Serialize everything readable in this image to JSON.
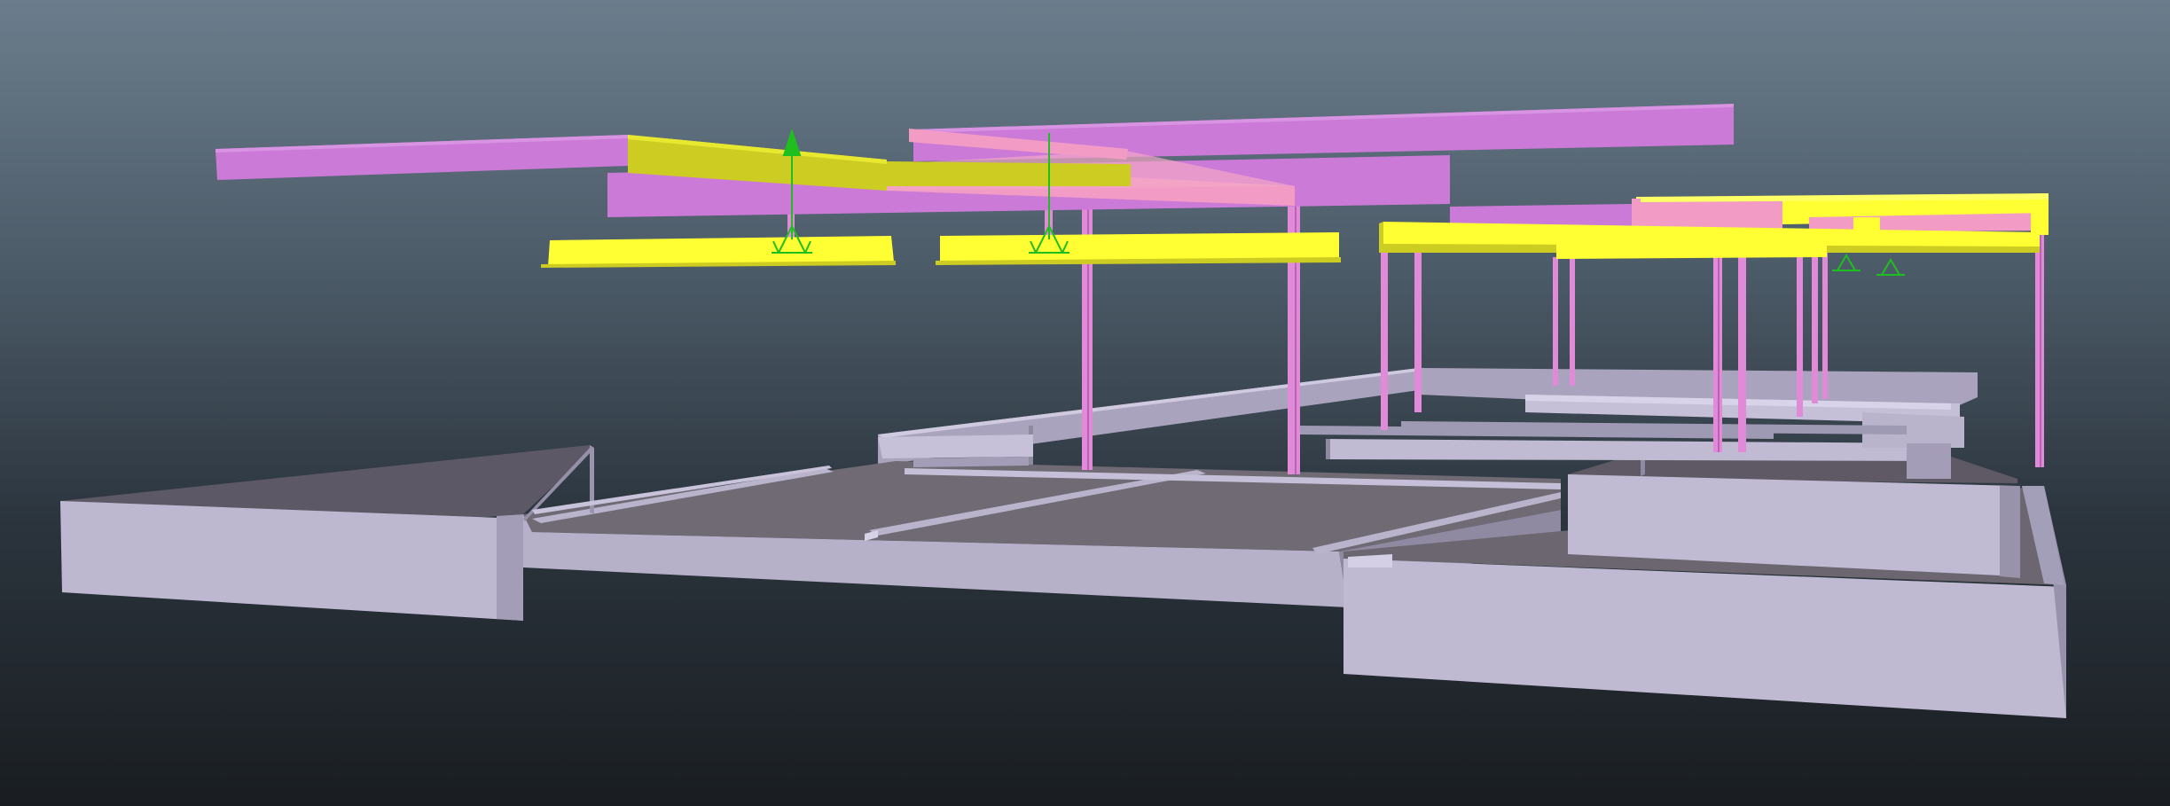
{
  "viewport": {
    "background_top": "#6b7d8c",
    "background_bottom": "#191d21"
  },
  "colors": {
    "slab_side": "#b8b2cc",
    "slab_top": "#6c6670",
    "slab_edge": "#8e8aa0",
    "wall_face": "#bfb9d2",
    "column": "#e08ad8",
    "column_dark": "#b863b4",
    "beam_magenta": "#cc7ad8",
    "beam_pink": "#f29bc4",
    "beam_yellow": "#ffff33",
    "beam_yellow_dark": "#cccc22",
    "symbol_green": "#1fbf1f"
  },
  "symbols": [
    {
      "name": "support-symbol-1",
      "icon": "green-arrow-icon"
    },
    {
      "name": "support-symbol-2",
      "icon": "green-arrow-icon"
    },
    {
      "name": "support-symbol-3",
      "icon": "green-arrow-icon"
    },
    {
      "name": "support-symbol-4",
      "icon": "green-arrow-icon"
    }
  ]
}
